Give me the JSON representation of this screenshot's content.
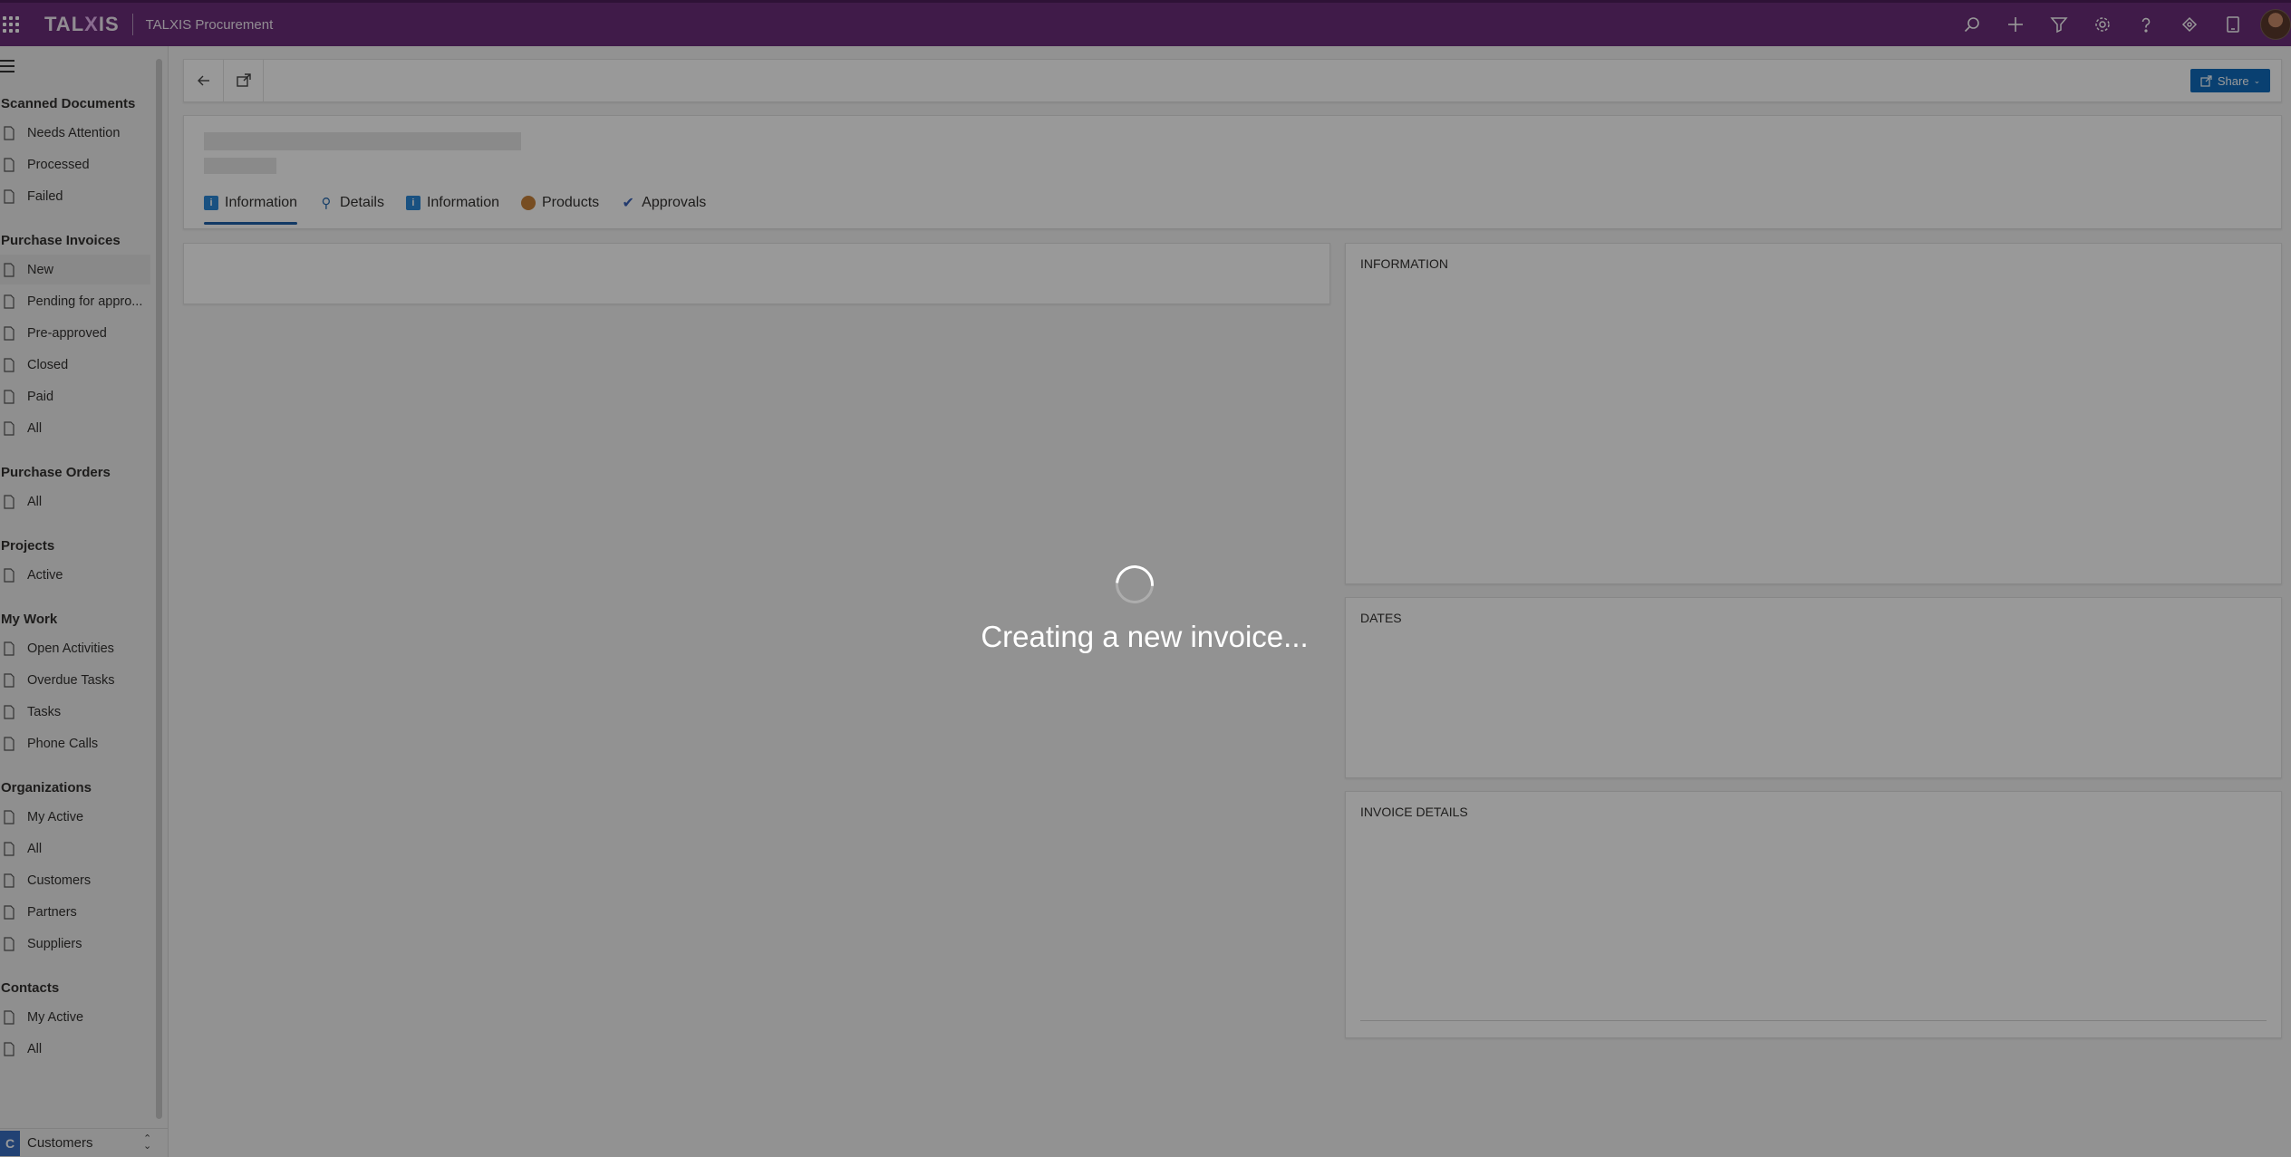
{
  "topbar": {
    "logo_left": "TAL",
    "logo_x": "X",
    "logo_right": "IS",
    "app_title": "TALXIS Procurement",
    "icons": [
      "search-icon",
      "plus-icon",
      "filter-icon",
      "gear-icon",
      "help-icon",
      "feedback-icon",
      "tablet-icon",
      "avatar"
    ]
  },
  "sidebar": {
    "groups": [
      {
        "title": "Scanned Documents",
        "items": [
          {
            "label": "Needs Attention",
            "icon": "doc-attention-icon"
          },
          {
            "label": "Processed",
            "icon": "doc-icon"
          },
          {
            "label": "Failed",
            "icon": "failed-icon"
          }
        ]
      },
      {
        "title": "Purchase Invoices",
        "items": [
          {
            "label": "New",
            "icon": "invoice-new-icon",
            "selected": true
          },
          {
            "label": "Pending for appro...",
            "icon": "doc-icon"
          },
          {
            "label": "Pre-approved",
            "icon": "doc-icon"
          },
          {
            "label": "Closed",
            "icon": "doc-icon"
          },
          {
            "label": "Paid",
            "icon": "paid-icon"
          },
          {
            "label": "All",
            "icon": "doc-list-icon"
          }
        ]
      },
      {
        "title": "Purchase Orders",
        "items": [
          {
            "label": "All",
            "icon": "clipboard-icon"
          }
        ]
      },
      {
        "title": "Projects",
        "items": [
          {
            "label": "Active",
            "icon": "project-icon"
          }
        ]
      },
      {
        "title": "My Work",
        "items": [
          {
            "label": "Open Activities",
            "icon": "activity-icon"
          },
          {
            "label": "Overdue Tasks",
            "icon": "warning-icon"
          },
          {
            "label": "Tasks",
            "icon": "task-icon"
          },
          {
            "label": "Phone Calls",
            "icon": "phone-icon"
          }
        ]
      },
      {
        "title": "Organizations",
        "items": [
          {
            "label": "My Active",
            "icon": "org-icon"
          },
          {
            "label": "All",
            "icon": "org-icon"
          },
          {
            "label": "Customers",
            "icon": "building-icon"
          },
          {
            "label": "Partners",
            "icon": "partner-icon"
          },
          {
            "label": "Suppliers",
            "icon": "supplier-icon"
          }
        ]
      },
      {
        "title": "Contacts",
        "items": [
          {
            "label": "My Active",
            "icon": "contact-icon"
          },
          {
            "label": "All",
            "icon": "contact-card-icon"
          }
        ]
      }
    ],
    "area_switcher": {
      "badge": "C",
      "label": "Customers"
    }
  },
  "commandbar": {
    "share_label": "Share"
  },
  "form": {
    "tabs": [
      {
        "label": "Information",
        "icon": "info-icon",
        "color": "#2b88d8",
        "active": true
      },
      {
        "label": "Details",
        "icon": "key-icon",
        "color": "#2b6cb0"
      },
      {
        "label": "Information",
        "icon": "info-icon",
        "color": "#2b88d8"
      },
      {
        "label": "Products",
        "icon": "box-icon",
        "color": "#c7803a"
      },
      {
        "label": "Approvals",
        "icon": "check-icon",
        "color": "#3a62b8"
      }
    ],
    "sections": {
      "information": "INFORMATION",
      "dates": "DATES",
      "invoice_details": "INVOICE DETAILS"
    }
  },
  "loading": {
    "message": "Creating a new invoice..."
  }
}
